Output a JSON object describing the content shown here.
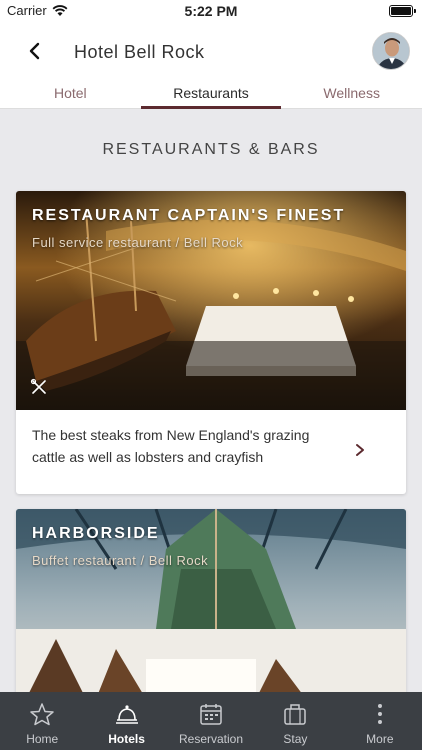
{
  "status_bar": {
    "carrier": "Carrier",
    "time": "5:22 PM"
  },
  "header": {
    "title": "Hotel Bell Rock",
    "back_icon": "chevron-left-icon",
    "avatar": "user-avatar"
  },
  "tabs": [
    {
      "label": "Hotel",
      "active": false
    },
    {
      "label": "Restaurants",
      "active": true
    },
    {
      "label": "Wellness",
      "active": false
    }
  ],
  "section": {
    "title": "RESTAURANTS & BARS"
  },
  "restaurants": [
    {
      "name": "RESTAURANT CAPTAIN'S FINEST",
      "subtitle": "Full service restaurant / Bell Rock",
      "description": "The best steaks from New England's grazing cattle as well as lobsters and crayfish",
      "icon": "cutlery-icon"
    },
    {
      "name": "HARBORSIDE",
      "subtitle": "Buffet restaurant / Bell Rock"
    }
  ],
  "nav": [
    {
      "label": "Home",
      "icon": "star-icon",
      "active": false
    },
    {
      "label": "Hotels",
      "icon": "bell-icon",
      "active": true
    },
    {
      "label": "Reservation",
      "icon": "calendar-icon",
      "active": false
    },
    {
      "label": "Stay",
      "icon": "suitcase-icon",
      "active": false
    },
    {
      "label": "More",
      "icon": "more-icon",
      "active": false
    }
  ],
  "colors": {
    "accent": "#5c2a2f",
    "navbar": "#3b3f44",
    "background": "#e9e9ec"
  }
}
